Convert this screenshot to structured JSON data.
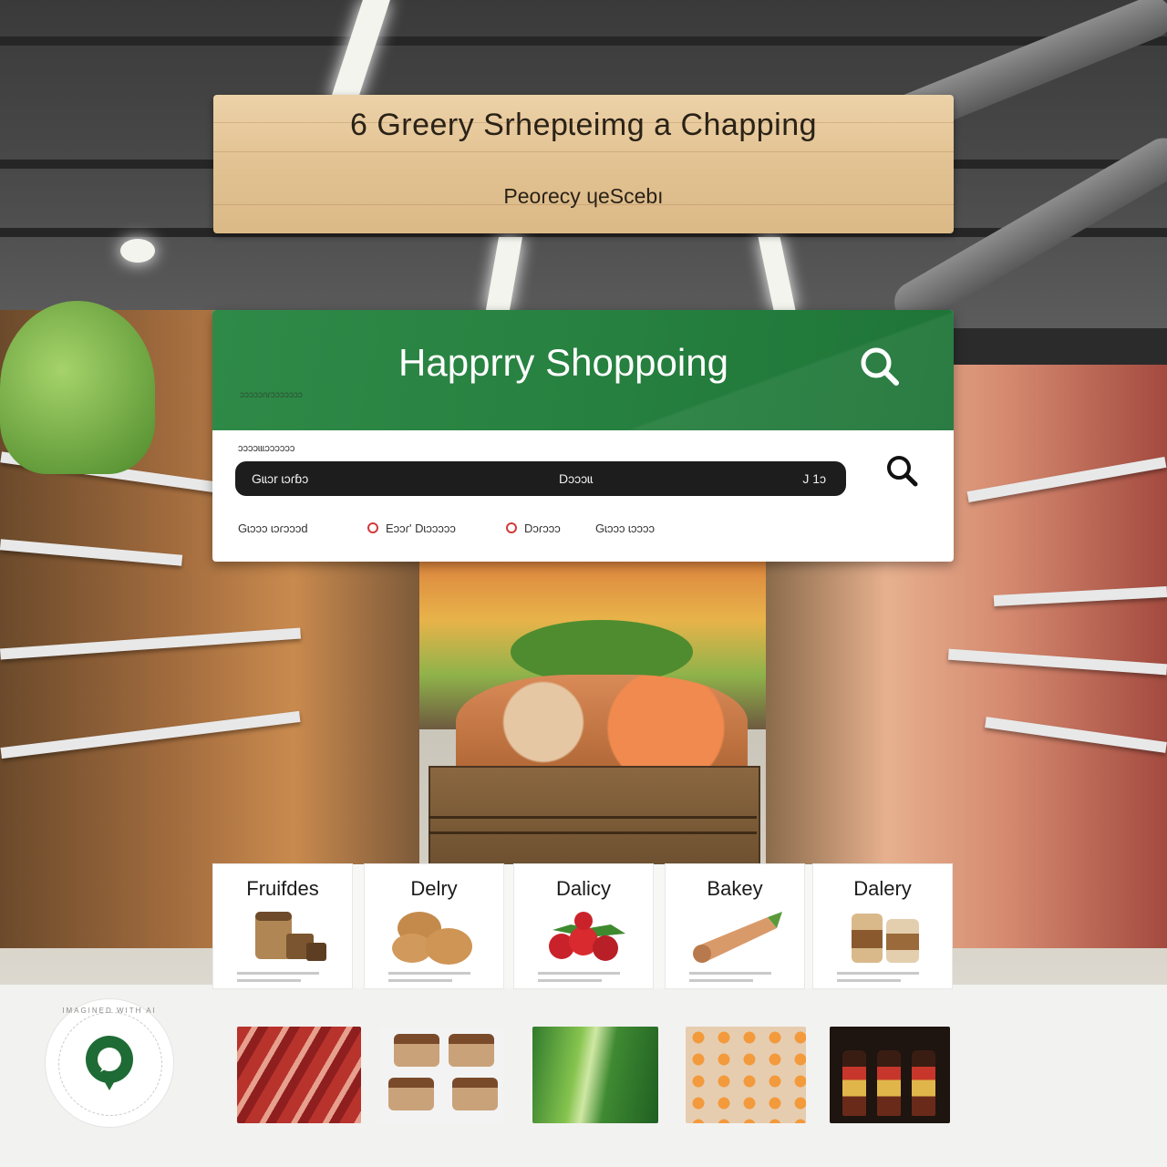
{
  "sign": {
    "title": "6 Greery Srhepɩeimg a Chapping",
    "subtitle": "Peoɾecy ɥeScebı"
  },
  "app": {
    "title": "Happrry Shoppoing",
    "tagline": "ɔɔɔɔɔɾɩɾɔɔɔɔɔɔɔ",
    "search_label": "ɔɔɔɔɩɩɩɔɔɔɔɔɔ",
    "search_bar": {
      "left_text": "Gɩɩɔr ɩɔɾɓɔ",
      "middle_text": "Dɔɔɔɩɩ",
      "right_text": "J 1ɔ"
    },
    "filters": [
      "Gɩɔɔɔ ɩɔɾɔɔɔd",
      "Eɔɔɾ' Dɩɔɔɔɔɔ",
      "Dɔɾɔɔɔ",
      "Gɩɔɔɔ ɩɔɔɔɔ"
    ]
  },
  "categories": [
    {
      "label": "Fruifdes"
    },
    {
      "label": "Delry"
    },
    {
      "label": "Dalicy"
    },
    {
      "label": "Bakey"
    },
    {
      "label": "Dalery"
    }
  ],
  "thumbnails": [
    {
      "icon": "meat-icon"
    },
    {
      "icon": "pastry-icon"
    },
    {
      "icon": "greens-icon"
    },
    {
      "icon": "produce-icon"
    },
    {
      "icon": "bottles-icon"
    }
  ],
  "badge": {
    "text": "IMAGINED WITH AI"
  },
  "colors": {
    "accent_green": "#26803f",
    "search_bar_bg": "#1d1d1d",
    "radio_red": "#d23a3a"
  }
}
